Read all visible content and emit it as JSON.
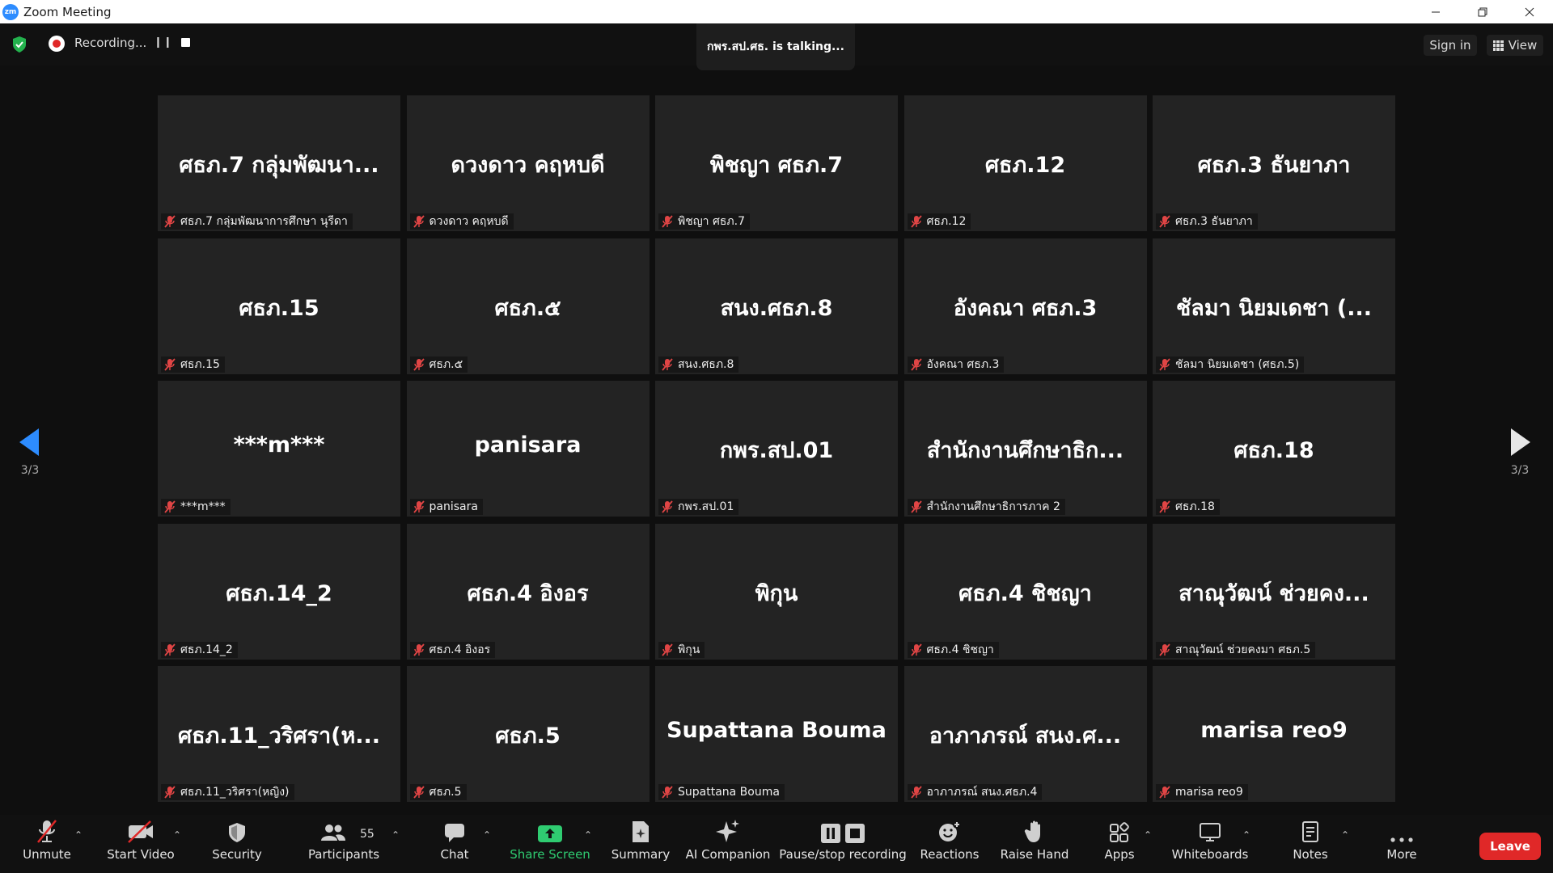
{
  "window": {
    "title": "Zoom Meeting",
    "logo_text": "zm"
  },
  "topbar": {
    "recording_label": "Recording...",
    "talking_text": "กพร.สป.ศธ. is  talking...",
    "signin_label": "Sign in",
    "view_label": "View"
  },
  "nav": {
    "left_page": "3/3",
    "right_page": "3/3"
  },
  "tiles": [
    {
      "name": "ศธภ.7 กลุ่มพัฒนา...",
      "label": "ศธภ.7 กลุ่มพัฒนาการศึกษา นุรีดา"
    },
    {
      "name": "ดวงดาว คฤหบดี",
      "label": "ดวงดาว คฤหบดี"
    },
    {
      "name": "พิชญา ศธภ.7",
      "label": "พิชญา ศธภ.7"
    },
    {
      "name": "ศธภ.12",
      "label": "ศธภ.12"
    },
    {
      "name": "ศธภ.3 ธันยาภา",
      "label": "ศธภ.3 ธันยาภา"
    },
    {
      "name": "ศธภ.15",
      "label": "ศธภ.15"
    },
    {
      "name": "ศธภ.๕",
      "label": "ศธภ.๕"
    },
    {
      "name": "สนง.ศธภ.8",
      "label": "สนง.ศธภ.8"
    },
    {
      "name": "อังคณา ศธภ.3",
      "label": "อังคณา ศธภ.3"
    },
    {
      "name": "ชัลมา นิยมเดชา (...",
      "label": "ชัลมา นิยมเดชา (ศธภ.5)"
    },
    {
      "name": "***m***",
      "label": "***m***"
    },
    {
      "name": "panisara",
      "label": "panisara"
    },
    {
      "name": "กพร.สป.01",
      "label": "กพร.สป.01"
    },
    {
      "name": "สำนักงานศึกษาธิก...",
      "label": "สำนักงานศึกษาธิการภาค 2"
    },
    {
      "name": "ศธภ.18",
      "label": "ศธภ.18"
    },
    {
      "name": "ศธภ.14_2",
      "label": "ศธภ.14_2"
    },
    {
      "name": "ศธภ.4 อิงอร",
      "label": "ศธภ.4 อิงอร"
    },
    {
      "name": "พิกุน",
      "label": "พิกุน"
    },
    {
      "name": "ศธภ.4 ชิชญา",
      "label": "ศธภ.4 ชิชญา"
    },
    {
      "name": "สาณุวัฒน์ ช่วยคง...",
      "label": "สาณุวัฒน์ ช่วยคงมา ศธภ.5"
    },
    {
      "name": "ศธภ.11_วริศรา(ห...",
      "label": "ศธภ.11_วริศรา(หญิง)"
    },
    {
      "name": "ศธภ.5",
      "label": "ศธภ.5"
    },
    {
      "name": "Supattana Bouma",
      "label": "Supattana Bouma"
    },
    {
      "name": "อาภาภรณ์ สนง.ศ...",
      "label": "อาภาภรณ์ สนง.ศธภ.4"
    },
    {
      "name": "marisa reo9",
      "label": "marisa reo9"
    }
  ],
  "toolbar": {
    "unmute": "Unmute",
    "start_video": "Start Video",
    "security": "Security",
    "participants": "Participants",
    "participants_count": "55",
    "chat": "Chat",
    "share_screen": "Share Screen",
    "summary": "Summary",
    "ai_companion": "AI Companion",
    "pause_stop_recording": "Pause/stop recording",
    "reactions": "Reactions",
    "raise_hand": "Raise Hand",
    "apps": "Apps",
    "whiteboards": "Whiteboards",
    "notes": "Notes",
    "more": "More",
    "leave": "Leave"
  },
  "colors": {
    "accent": "#2d8cff",
    "share_green": "#2fcc71",
    "leave_red": "#e02828",
    "recording_red": "#e02828"
  }
}
